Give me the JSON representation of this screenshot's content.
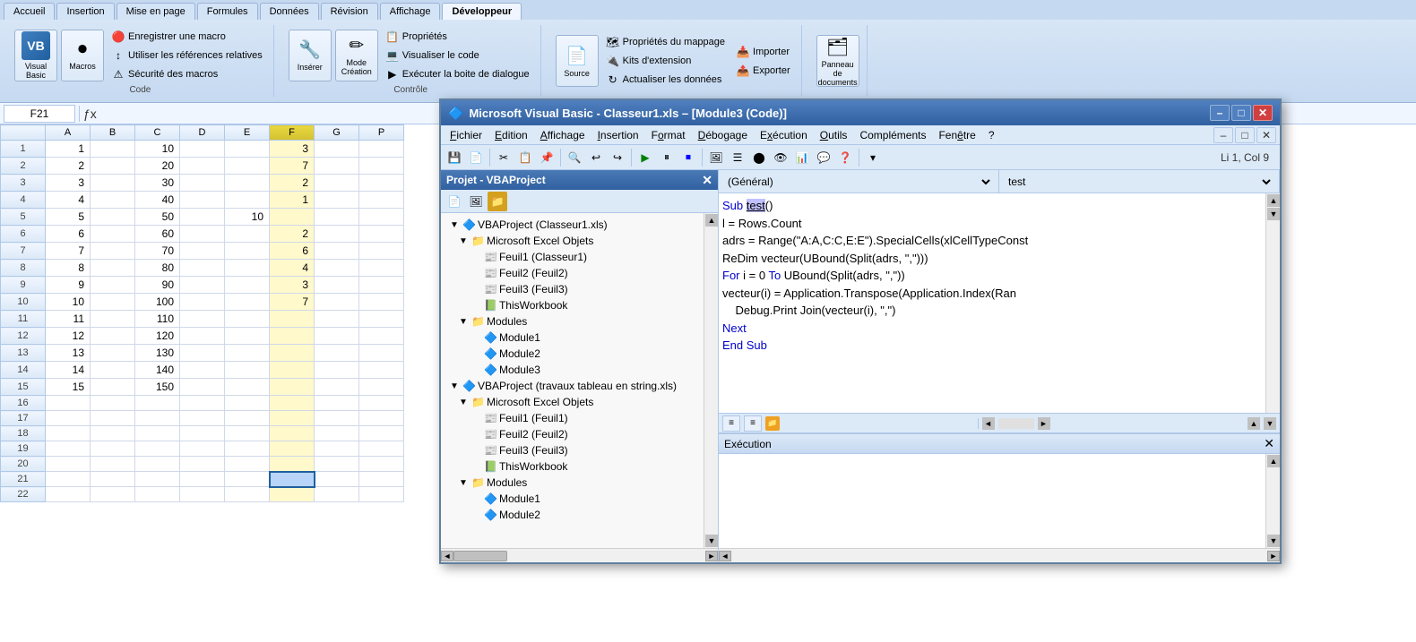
{
  "ribbon": {
    "tabs": [
      "Accueil",
      "Insertion",
      "Mise en page",
      "Formules",
      "Données",
      "Révision",
      "Affichage",
      "Développeur"
    ],
    "active_tab": "Développeur",
    "groups": {
      "code": {
        "label": "Code",
        "buttons": {
          "visual_basic": "Visual\nBasic",
          "macros": "Macros",
          "enregistrer": "Enregistrer une macro",
          "references": "Utiliser les références relatives",
          "securite": "Sécurité des macros",
          "inserer": "Insérer",
          "mode_creation": "Mode\nCréation",
          "proprietes": "Propriétés",
          "visualiser": "Visualiser le code",
          "executer": "Exécuter la boite de dialogue"
        }
      },
      "controles": {
        "label": "Contrôle"
      },
      "xml": {
        "label": "",
        "buttons": {
          "source": "Source",
          "proprietes_mappage": "Propriétés du mappage",
          "kits": "Kits d'extension",
          "actualiser": "Actualiser les données",
          "importer": "Importer",
          "exporter": "Exporter"
        }
      },
      "panneau": {
        "label": "",
        "buttons": {
          "panneau": "Panneau de\ndocuments"
        }
      }
    }
  },
  "formula_bar": {
    "cell_name": "F21",
    "formula": ""
  },
  "spreadsheet": {
    "columns": [
      "",
      "A",
      "B",
      "C",
      "D",
      "E",
      "F",
      "G",
      "P"
    ],
    "rows": [
      {
        "num": "1",
        "a": "1",
        "b": "",
        "c": "10",
        "d": "",
        "e": "",
        "f": "3",
        "g": ""
      },
      {
        "num": "2",
        "a": "2",
        "b": "",
        "c": "20",
        "d": "",
        "e": "",
        "f": "7",
        "g": ""
      },
      {
        "num": "3",
        "a": "3",
        "b": "",
        "c": "30",
        "d": "",
        "e": "",
        "f": "2",
        "g": ""
      },
      {
        "num": "4",
        "a": "4",
        "b": "",
        "c": "40",
        "d": "",
        "e": "",
        "f": "1",
        "g": ""
      },
      {
        "num": "5",
        "a": "5",
        "b": "",
        "c": "50",
        "d": "",
        "e": "10",
        "f": "",
        "g": ""
      },
      {
        "num": "6",
        "a": "6",
        "b": "",
        "c": "60",
        "d": "",
        "e": "",
        "f": "2",
        "g": ""
      },
      {
        "num": "7",
        "a": "7",
        "b": "",
        "c": "70",
        "d": "",
        "e": "",
        "f": "6",
        "g": ""
      },
      {
        "num": "8",
        "a": "8",
        "b": "",
        "c": "80",
        "d": "",
        "e": "",
        "f": "4",
        "g": ""
      },
      {
        "num": "9",
        "a": "9",
        "b": "",
        "c": "90",
        "d": "",
        "e": "",
        "f": "3",
        "g": ""
      },
      {
        "num": "10",
        "a": "10",
        "b": "",
        "c": "100",
        "d": "",
        "e": "",
        "f": "7",
        "g": ""
      },
      {
        "num": "11",
        "a": "11",
        "b": "",
        "c": "110",
        "d": "",
        "e": "",
        "f": "",
        "g": ""
      },
      {
        "num": "12",
        "a": "12",
        "b": "",
        "c": "120",
        "d": "",
        "e": "",
        "f": "",
        "g": ""
      },
      {
        "num": "13",
        "a": "13",
        "b": "",
        "c": "130",
        "d": "",
        "e": "",
        "f": "",
        "g": ""
      },
      {
        "num": "14",
        "a": "14",
        "b": "",
        "c": "140",
        "d": "",
        "e": "",
        "f": "",
        "g": ""
      },
      {
        "num": "15",
        "a": "15",
        "b": "",
        "c": "150",
        "d": "",
        "e": "",
        "f": "",
        "g": ""
      },
      {
        "num": "16",
        "a": "",
        "b": "",
        "c": "",
        "d": "",
        "e": "",
        "f": "",
        "g": ""
      },
      {
        "num": "17",
        "a": "",
        "b": "",
        "c": "",
        "d": "",
        "e": "",
        "f": "",
        "g": ""
      },
      {
        "num": "18",
        "a": "",
        "b": "",
        "c": "",
        "d": "",
        "e": "",
        "f": "",
        "g": ""
      },
      {
        "num": "19",
        "a": "",
        "b": "",
        "c": "",
        "d": "",
        "e": "",
        "f": "",
        "g": ""
      },
      {
        "num": "20",
        "a": "",
        "b": "",
        "c": "",
        "d": "",
        "e": "",
        "f": "",
        "g": ""
      },
      {
        "num": "21",
        "a": "",
        "b": "",
        "c": "",
        "d": "",
        "e": "",
        "f": "",
        "g": ""
      },
      {
        "num": "22",
        "a": "",
        "b": "",
        "c": "",
        "d": "",
        "e": "",
        "f": "",
        "g": ""
      }
    ]
  },
  "vba_window": {
    "title": "Microsoft Visual Basic - Classeur1.xls – [Module3 (Code)]",
    "cursor_info": "Li 1, Col 9",
    "menu_items": [
      "Fichier",
      "Edition",
      "Affichage",
      "Insertion",
      "Format",
      "Débogage",
      "Exécution",
      "Outils",
      "Compléments",
      "Fenêtre",
      "?"
    ],
    "project_panel": {
      "title": "Projet - VBAProject",
      "projects": [
        {
          "name": "VBAProject (Classeur1.xls)",
          "children": [
            {
              "name": "Microsoft Excel Objets",
              "children": [
                {
                  "name": "Feuil1 (Classeur1)"
                },
                {
                  "name": "Feuil2 (Feuil2)"
                },
                {
                  "name": "Feuil3 (Feuil3)"
                },
                {
                  "name": "ThisWorkbook"
                }
              ]
            },
            {
              "name": "Modules",
              "children": [
                {
                  "name": "Module1"
                },
                {
                  "name": "Module2"
                },
                {
                  "name": "Module3"
                }
              ]
            }
          ]
        },
        {
          "name": "VBAProject (travaux tableau en string.xls)",
          "children": [
            {
              "name": "Microsoft Excel Objets",
              "children": [
                {
                  "name": "Feuil1 (Feuil1)"
                },
                {
                  "name": "Feuil2 (Feuil2)"
                },
                {
                  "name": "Feuil3 (Feuil3)"
                },
                {
                  "name": "ThisWorkbook"
                }
              ]
            },
            {
              "name": "Modules",
              "children": [
                {
                  "name": "Module1"
                },
                {
                  "name": "Module2"
                }
              ]
            }
          ]
        }
      ]
    },
    "code_dropdown_left": "(Général)",
    "code_dropdown_right": "test",
    "code_lines": [
      "Sub test()",
      "l = Rows.Count",
      "adrs = Range(\"A:A,C:C,E:E\").SpecialCells(xlCellTypeConst",
      "ReDim vecteur(UBound(Split(adrs, \",\")))",
      "For i = 0 To UBound(Split(adrs, \",\"))",
      "vecteur(i) = Application.Transpose(Application.Index(Ran",
      "    Debug.Print Join(vecteur(i), \",\")",
      "Next",
      "End Sub"
    ],
    "execution_panel": {
      "title": "Exécution",
      "content": ""
    }
  }
}
